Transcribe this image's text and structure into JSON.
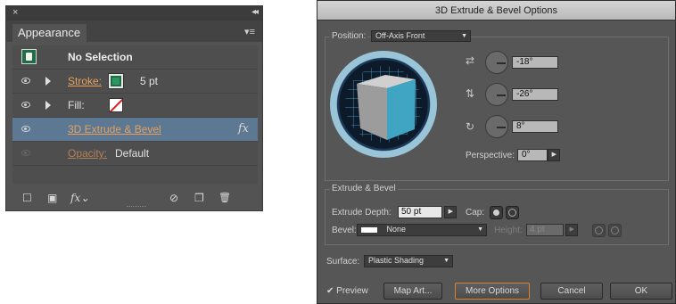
{
  "appearance_panel": {
    "close_glyph": "×",
    "collapse_glyph": "◂◂",
    "tab_label": "Appearance",
    "menu_glyph": "▾≡",
    "rows": {
      "object": {
        "label": "No Selection"
      },
      "stroke": {
        "label": "Stroke:",
        "value": "5 pt",
        "swatch_color": "#1f6d45"
      },
      "fill": {
        "label": "Fill:",
        "swatch": "none (white with red slash)"
      },
      "effect": {
        "label": "3D Extrude & Bevel",
        "fx": "fx"
      },
      "opacity": {
        "label": "Opacity:",
        "value": "Default"
      }
    },
    "footer": {
      "new_art_icon": "☐",
      "clear_icon": "▣",
      "fx_label": "fx",
      "fx_caret": "⌄",
      "no_icon": "⊘",
      "duplicate_icon": "❐",
      "delete_icon": "🗑"
    }
  },
  "dialog": {
    "title": "3D Extrude & Bevel Options",
    "position": {
      "label": "Position:",
      "value": "Off-Axis Front",
      "x_rotation": "-18°",
      "y_rotation": "-26°",
      "z_rotation": "8°",
      "perspective_label": "Perspective:",
      "perspective_value": "0°",
      "cube_front_color": "#3fa5c2",
      "cube_side_color": "#9c9c9c",
      "cube_top_color": "#d0d0d0"
    },
    "extrude": {
      "section_label": "Extrude & Bevel",
      "depth_label": "Extrude Depth:",
      "depth_value": "50 pt",
      "cap_label": "Cap:",
      "bevel_label": "Bevel:",
      "bevel_value": "None",
      "height_label": "Height:",
      "height_value": "4 pt"
    },
    "surface": {
      "label": "Surface:",
      "value": "Plastic Shading"
    },
    "preview_label": "Preview",
    "buttons": {
      "map_art": "Map Art...",
      "more_options": "More Options",
      "cancel": "Cancel",
      "ok": "OK"
    }
  },
  "colors": {
    "panel_bg": "#535353",
    "selection_bg": "#5c7893",
    "link_orange": "#e8a05a",
    "focus_orange": "#d9822b"
  }
}
